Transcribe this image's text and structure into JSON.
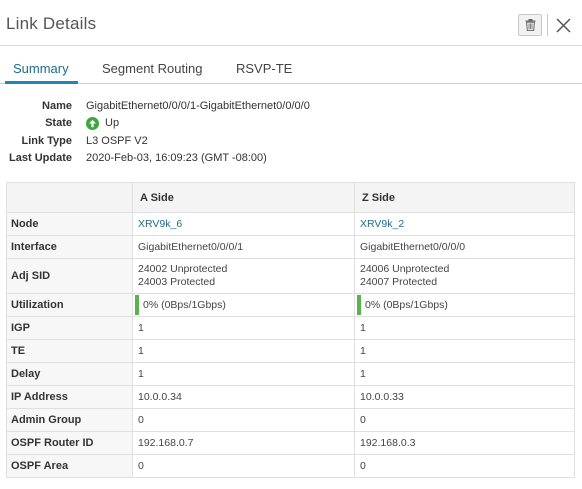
{
  "header": {
    "title": "Link Details"
  },
  "tabs": [
    {
      "label": "Summary",
      "active": true
    },
    {
      "label": "Segment Routing",
      "active": false
    },
    {
      "label": "RSVP-TE",
      "active": false
    }
  ],
  "summary": {
    "name_label": "Name",
    "name_value": "GigabitEthernet0/0/0/1-GigabitEthernet0/0/0/0",
    "state_label": "State",
    "state_value": "Up",
    "link_type_label": "Link Type",
    "link_type_value": "L3 OSPF V2",
    "last_update_label": "Last Update",
    "last_update_value": "2020-Feb-03, 16:09:23 (GMT -08:00)"
  },
  "table": {
    "headers": [
      "",
      "A Side",
      "Z Side"
    ],
    "rows": [
      {
        "label": "Node",
        "a": "XRV9k_6",
        "z": "XRV9k_2"
      },
      {
        "label": "Interface",
        "a": "GigabitEthernet0/0/0/1",
        "z": "GigabitEthernet0/0/0/0"
      },
      {
        "label": "Adj SID",
        "a": [
          "24002 Unprotected",
          "24003 Protected"
        ],
        "z": [
          "24006 Unprotected",
          "24007 Protected"
        ]
      },
      {
        "label": "Utilization",
        "a": "0% (0Bps/1Gbps)",
        "z": "0% (0Bps/1Gbps)"
      },
      {
        "label": "IGP",
        "a": "1",
        "z": "1"
      },
      {
        "label": "TE",
        "a": "1",
        "z": "1"
      },
      {
        "label": "Delay",
        "a": "1",
        "z": "1"
      },
      {
        "label": "IP Address",
        "a": "10.0.0.34",
        "z": "10.0.0.33"
      },
      {
        "label": "Admin Group",
        "a": "0",
        "z": "0"
      },
      {
        "label": "OSPF Router ID",
        "a": "192.168.0.7",
        "z": "192.168.0.3"
      },
      {
        "label": "OSPF Area",
        "a": "0",
        "z": "0"
      }
    ]
  },
  "colors": {
    "accent": "#1d86b3",
    "link": "#1d6d8a",
    "status_up": "#3aa83a",
    "utilization_bar": "#58b34a"
  },
  "icons": {
    "delete": "trash-icon",
    "close": "close-icon",
    "state": "arrow-up-circle-icon"
  }
}
